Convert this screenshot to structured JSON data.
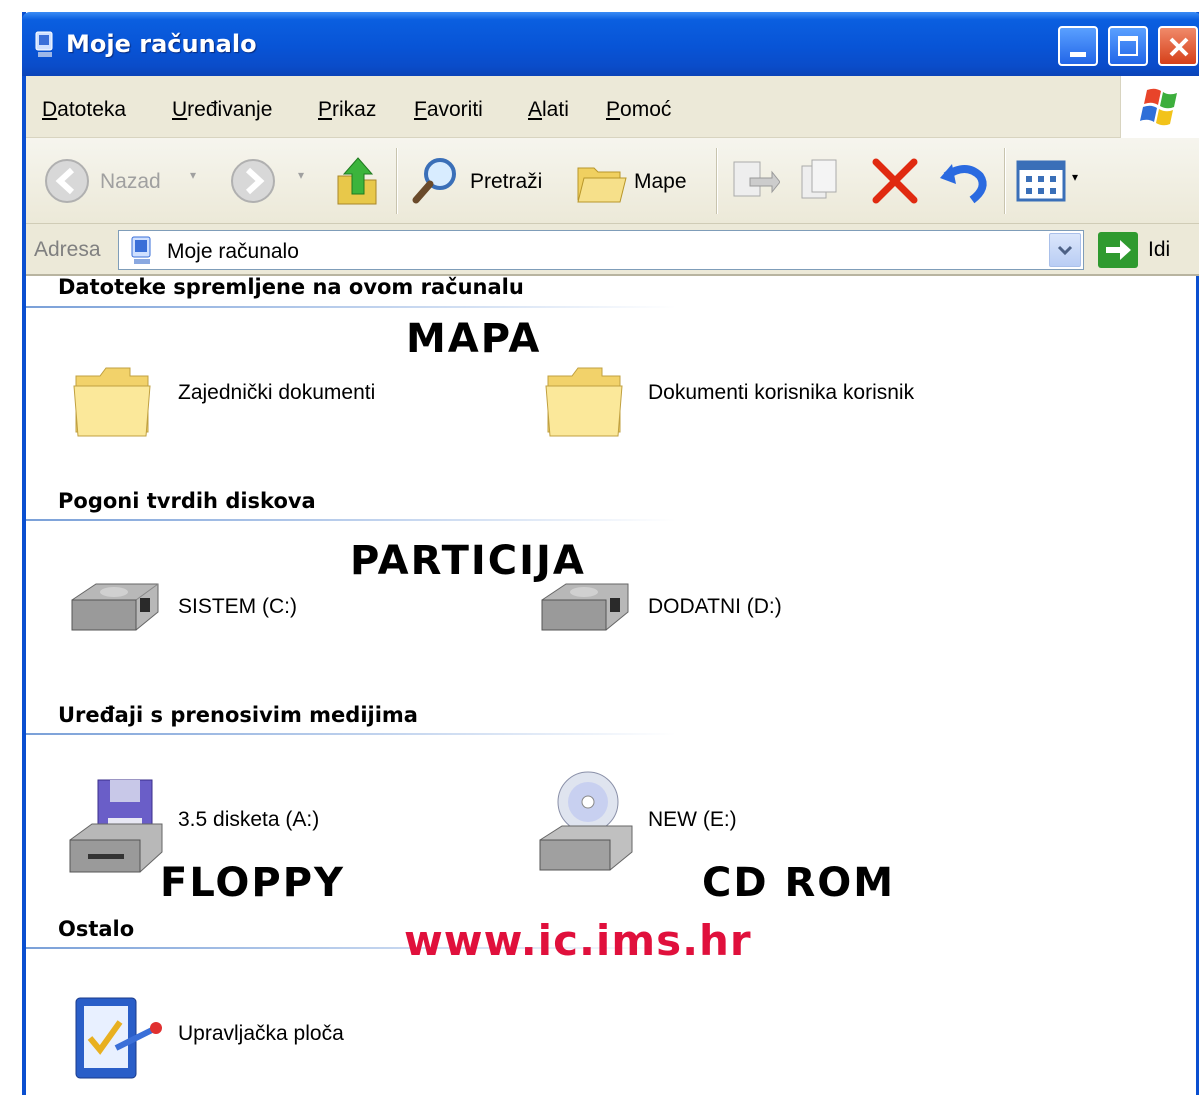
{
  "window": {
    "title": "Moje računalo"
  },
  "menu": [
    "Datoteka",
    "Uređivanje",
    "Prikaz",
    "Favoriti",
    "Alati",
    "Pomoć"
  ],
  "toolbar": {
    "back_label": "Nazad",
    "search_label": "Pretraži",
    "folders_label": "Mape"
  },
  "address": {
    "label": "Adresa",
    "value": "Moje računalo",
    "go_label": "Idi"
  },
  "sections": [
    {
      "title": "Datoteke spremljene na ovom računalu",
      "items": [
        "Zajednički dokumenti",
        "Dokumenti korisnika korisnik"
      ]
    },
    {
      "title": "Pogoni tvrdih diskova",
      "items": [
        "SISTEM (C:)",
        "DODATNI (D:)"
      ]
    },
    {
      "title": "Uređaji s prenosivim medijima",
      "items": [
        "3.5 disketa (A:)",
        "NEW (E:)"
      ]
    },
    {
      "title": "Ostalo",
      "items": [
        "Upravljačka ploča"
      ]
    }
  ],
  "annotations": {
    "mapa": "MAPA",
    "particija": "PARTICIJA",
    "floppy": "FLOPPY",
    "cdrom": "CD ROM",
    "url": "www.ic.ims.hr"
  },
  "colors": {
    "titlebar": "#0854d6",
    "menubar": "#ece9d8",
    "url": "#e0103c"
  }
}
